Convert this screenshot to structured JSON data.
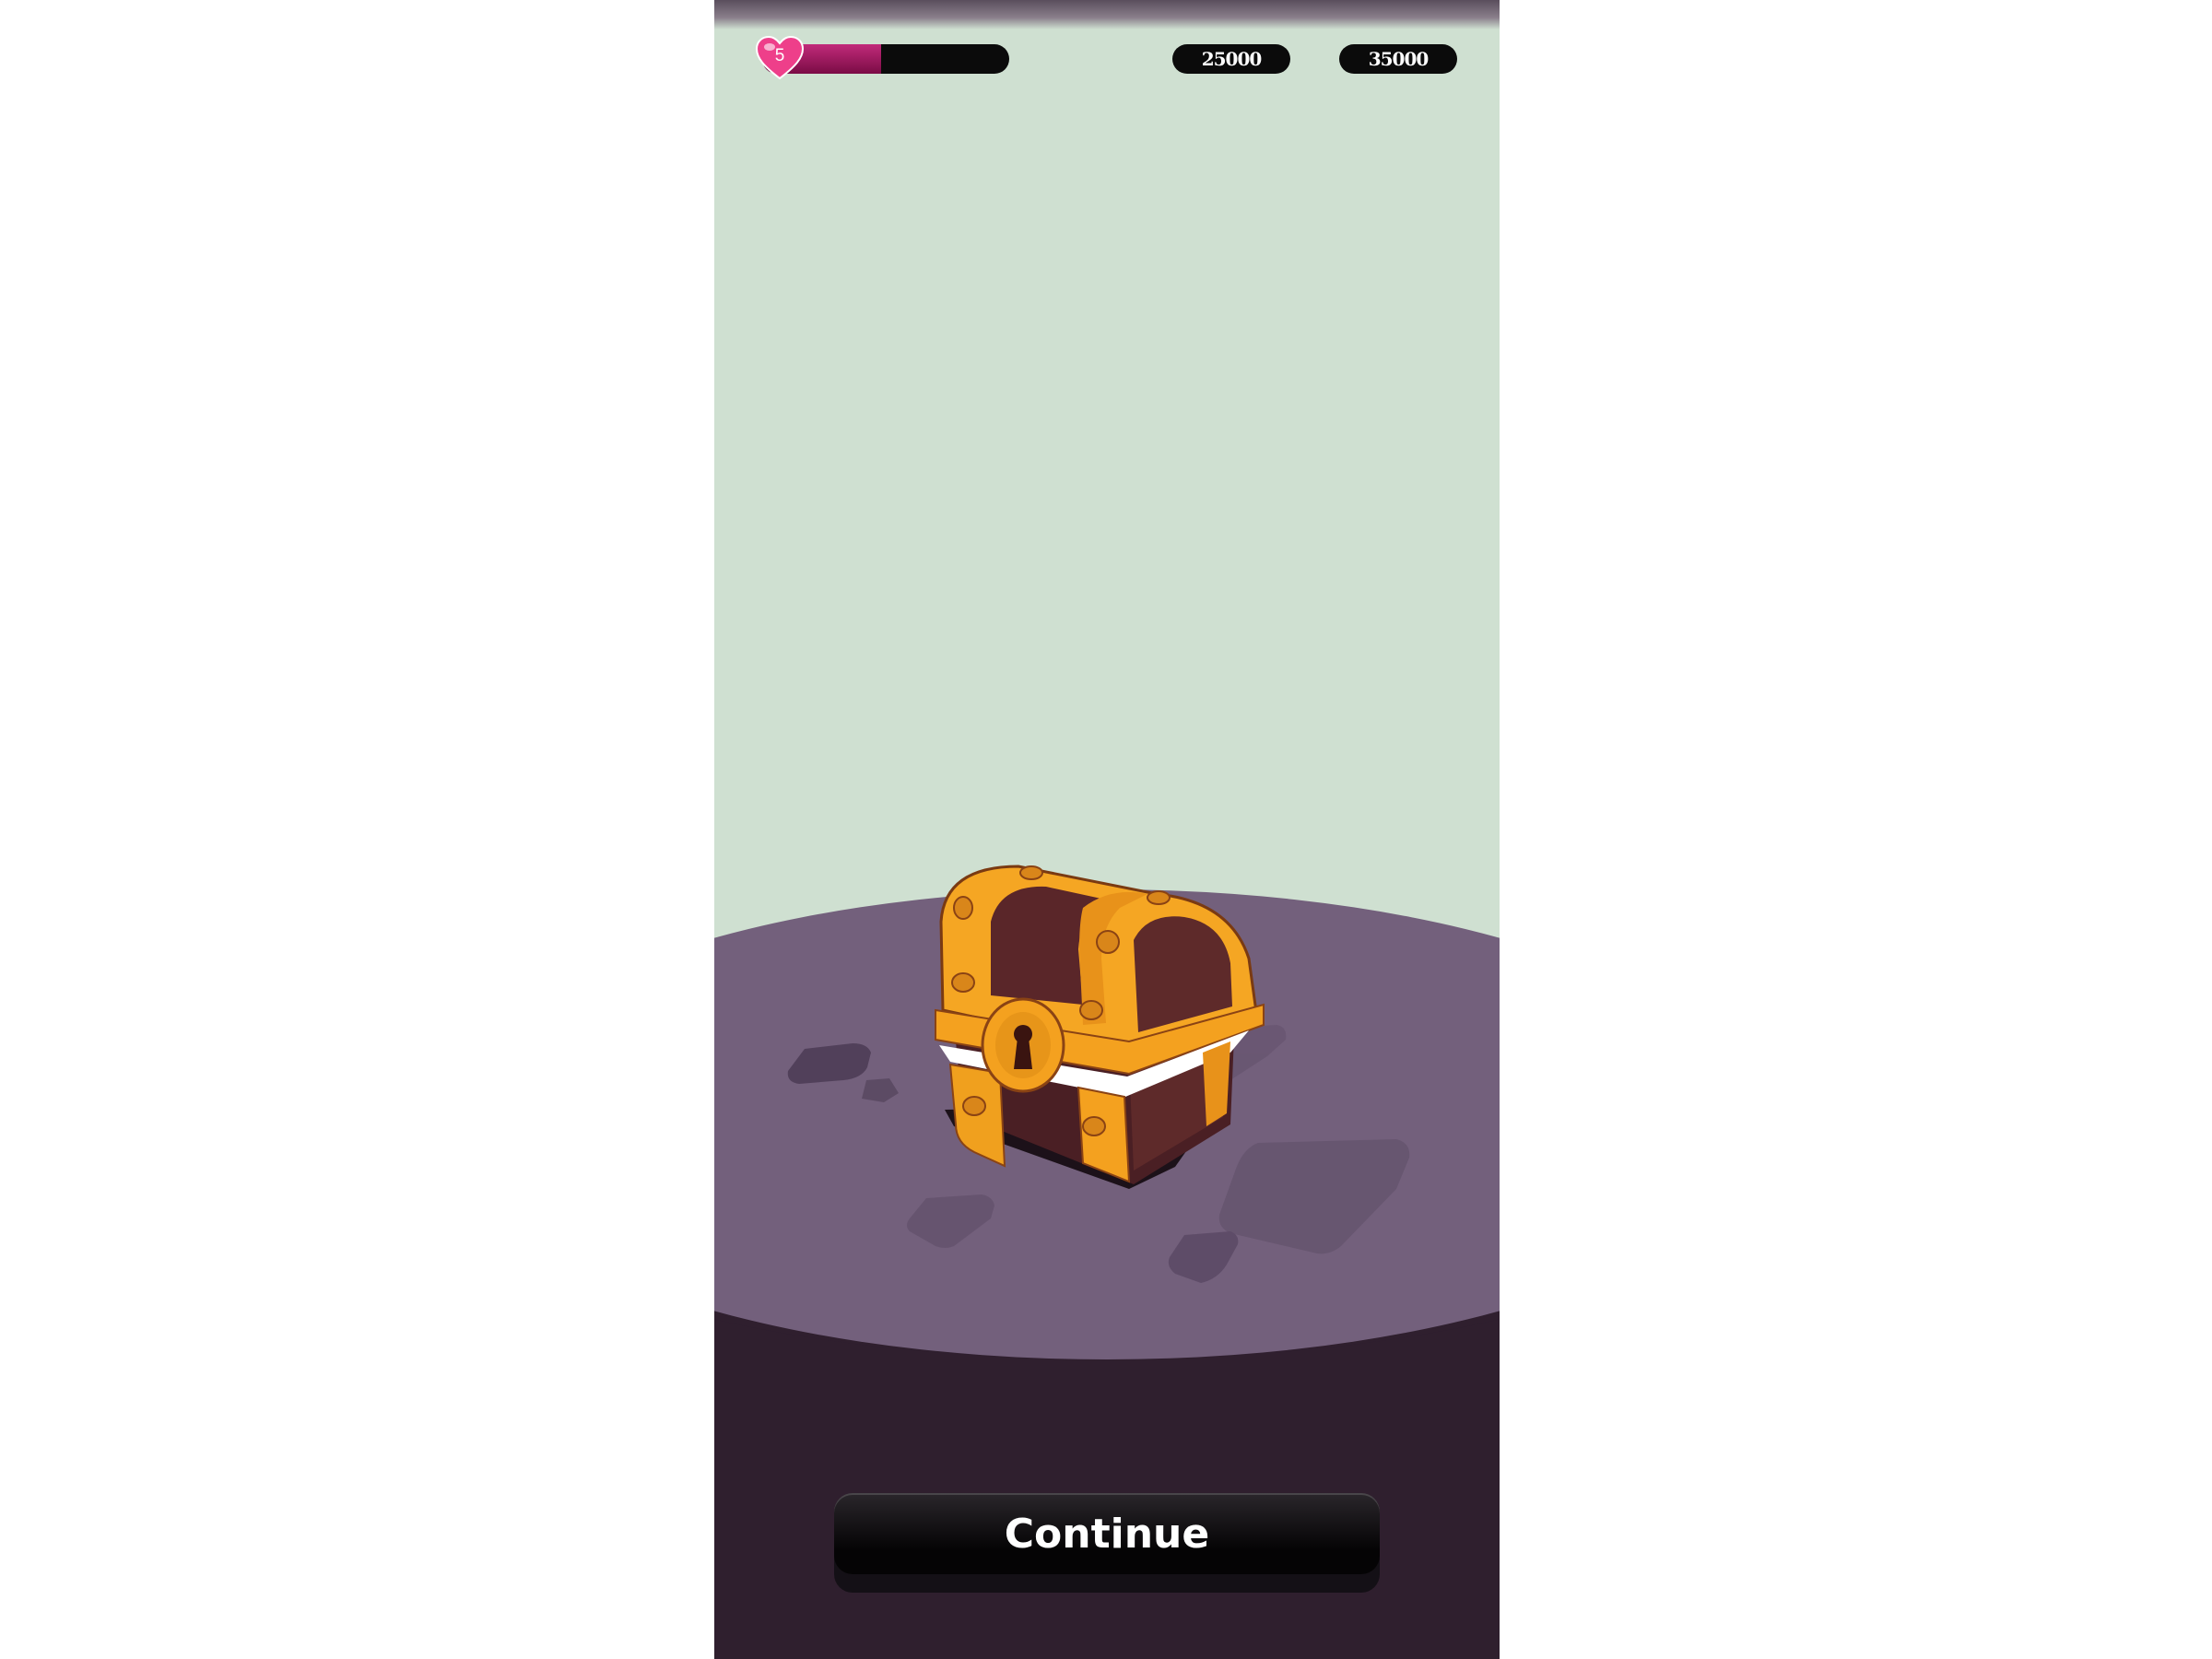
{
  "hud": {
    "lives_count": "5",
    "lives_progress": 0.48,
    "currency_1": "25000",
    "currency_2": "35000"
  },
  "scene": {
    "item": "treasure-chest"
  },
  "footer": {
    "continue_label": "Continue"
  },
  "colors": {
    "sky": "#cfe0d1",
    "platform_top": "#73607c",
    "platform_side": "#2f1f2e",
    "chest_gold": "#f5a623",
    "chest_wood": "#5e2a2a",
    "heart": "#ee3f8a",
    "lives_fill": "#c12a7a"
  }
}
